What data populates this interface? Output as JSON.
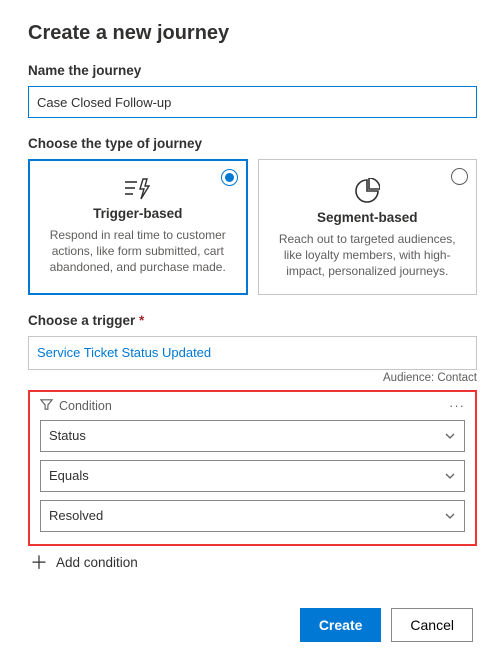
{
  "page_title": "Create a new journey",
  "name_section": {
    "label": "Name the journey",
    "value": "Case Closed Follow-up"
  },
  "type_section": {
    "label": "Choose the type of journey",
    "cards": [
      {
        "title": "Trigger-based",
        "desc": "Respond in real time to customer actions, like form submitted, cart abandoned, and purchase made.",
        "selected": true
      },
      {
        "title": "Segment-based",
        "desc": "Reach out to targeted audiences, like loyalty members, with high-impact, personalized journeys.",
        "selected": false
      }
    ]
  },
  "trigger_section": {
    "label": "Choose a trigger ",
    "required": "*",
    "value": "Service Ticket Status Updated",
    "audience": "Audience: Contact"
  },
  "condition": {
    "label": "Condition",
    "attribute": "Status",
    "operator": "Equals",
    "value": "Resolved"
  },
  "add_condition": "Add condition",
  "footer": {
    "create": "Create",
    "cancel": "Cancel"
  }
}
